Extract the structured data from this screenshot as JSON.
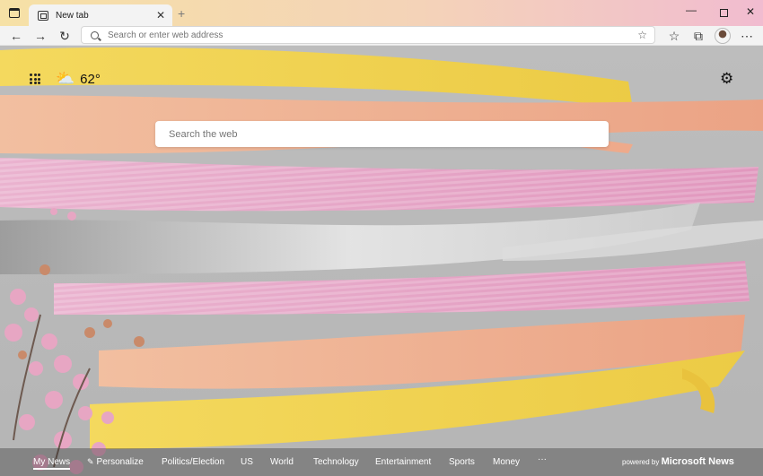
{
  "tab": {
    "title": "New tab"
  },
  "addressbar": {
    "placeholder": "Search or enter web address"
  },
  "weather": {
    "temperature": "62°",
    "icon": "partly-cloudy-icon"
  },
  "search": {
    "placeholder": "Search the web"
  },
  "news": {
    "items": [
      "My News",
      "Personalize",
      "Politics/Election",
      "US",
      "World",
      "Technology",
      "Entertainment",
      "Sports",
      "Money"
    ],
    "more": "···",
    "powered_prefix": "powered by",
    "powered_brand": "Microsoft News"
  },
  "colors": {
    "yellow": "#f2d45a",
    "peach": "#f0b596",
    "pink": "#e9a6c8",
    "silver": "#d9d9d9",
    "background": "#bababa"
  }
}
